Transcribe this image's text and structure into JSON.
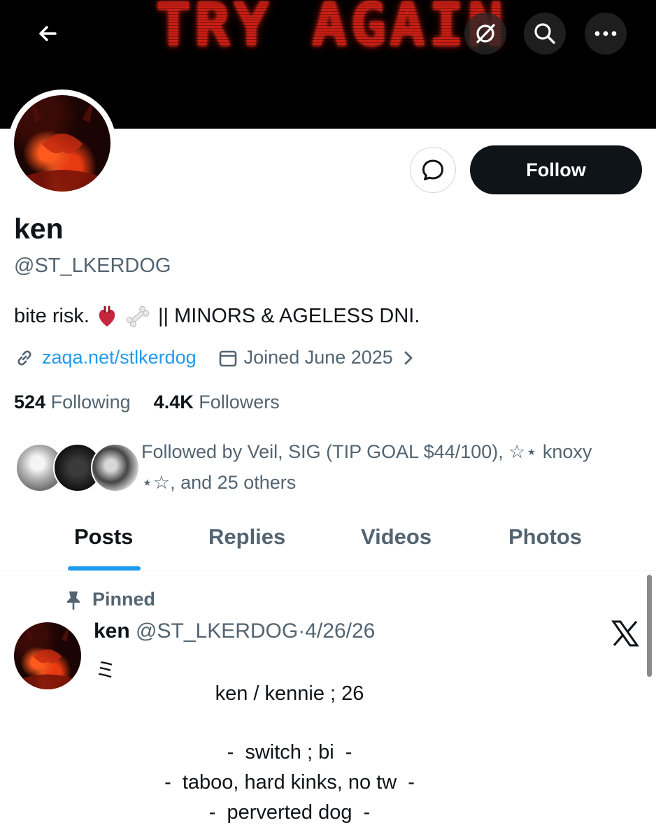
{
  "banner": {
    "text": "TRY AGAIN"
  },
  "icons": {
    "back": "arrow-left-icon",
    "grok": "grok-icon",
    "search": "search-icon",
    "more": "more-icon",
    "message": "message-icon",
    "link": "link-icon",
    "calendar": "calendar-icon",
    "pin": "pin-icon",
    "x": "x-logo-icon"
  },
  "profile": {
    "name": "ken",
    "handle": "@ST_LKERDOG",
    "bio_before": "bite risk.",
    "bio_after": "|| MINORS & AGELESS DNI.",
    "link": "zaqa.net/stlkerdog",
    "joined": "Joined June 2025",
    "following_count": "524",
    "following_label": "Following",
    "followers_count": "4.4K",
    "followers_label": "Followers",
    "followed_by": "Followed by Veil, SIG (TIP GOAL $44/100), ☆⋆ knoxy ⋆☆, and 25 others",
    "follow_label": "Follow"
  },
  "tabs": [
    "Posts",
    "Replies",
    "Videos",
    "Photos"
  ],
  "post": {
    "pinned_label": "Pinned",
    "author": "ken",
    "handle": "@ST_LKERDOG",
    "sep": "·",
    "date": "4/26/26",
    "squiggle": "ミ",
    "lines": [
      "ken / kennie ; 26",
      "-  switch ; bi  -",
      "-  taboo, hard kinks, no tw  -",
      "-  perverted dog  -"
    ]
  },
  "colors": {
    "accent": "#1d9bf0",
    "banner_text": "#c81e14"
  }
}
